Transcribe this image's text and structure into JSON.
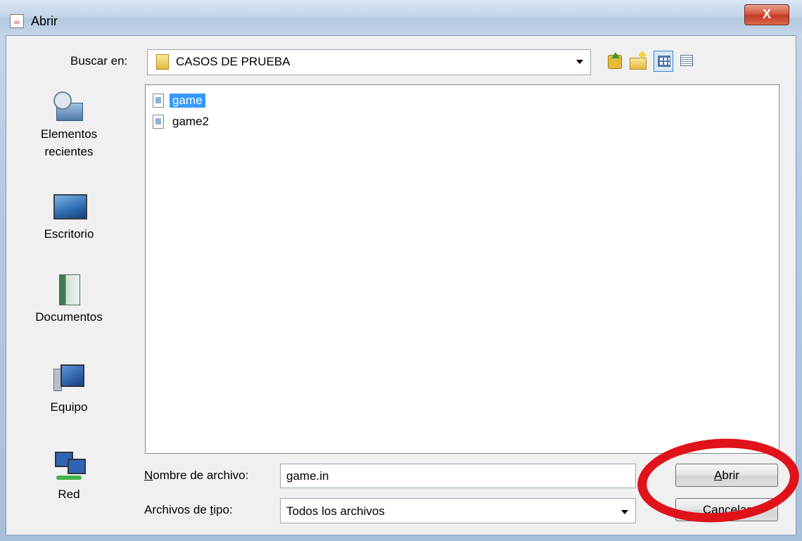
{
  "window": {
    "title": "Abrir",
    "close_label": "X"
  },
  "lookin": {
    "label": "Buscar en:",
    "value": "CASOS DE PRUEBA"
  },
  "toolbar": {
    "icons": [
      "up-folder-icon",
      "new-folder-icon",
      "list-view-icon",
      "details-view-icon"
    ]
  },
  "places": [
    {
      "label_line1": "Elementos",
      "label_line2": "recientes"
    },
    {
      "label": "Escritorio"
    },
    {
      "label": "Documentos"
    },
    {
      "label": "Equipo"
    },
    {
      "label": "Red"
    }
  ],
  "files": [
    {
      "name": "game",
      "selected": true
    },
    {
      "name": "game2",
      "selected": false
    }
  ],
  "form": {
    "filename_label": "Nombre de archivo:",
    "filename_value": "game.in",
    "filetype_label_pre": "Archivos de ",
    "filetype_label_mnemonic": "t",
    "filetype_label_post": "ipo:",
    "filename_label_mnemonic": "N",
    "filename_label_rest": "ombre de archivo:",
    "filetype_value": "Todos los archivos"
  },
  "buttons": {
    "open_mnemonic": "A",
    "open_rest": "brir",
    "cancel": "Cancelar"
  },
  "colors": {
    "selection": "#3399ff",
    "annotation": "#e0121a"
  }
}
